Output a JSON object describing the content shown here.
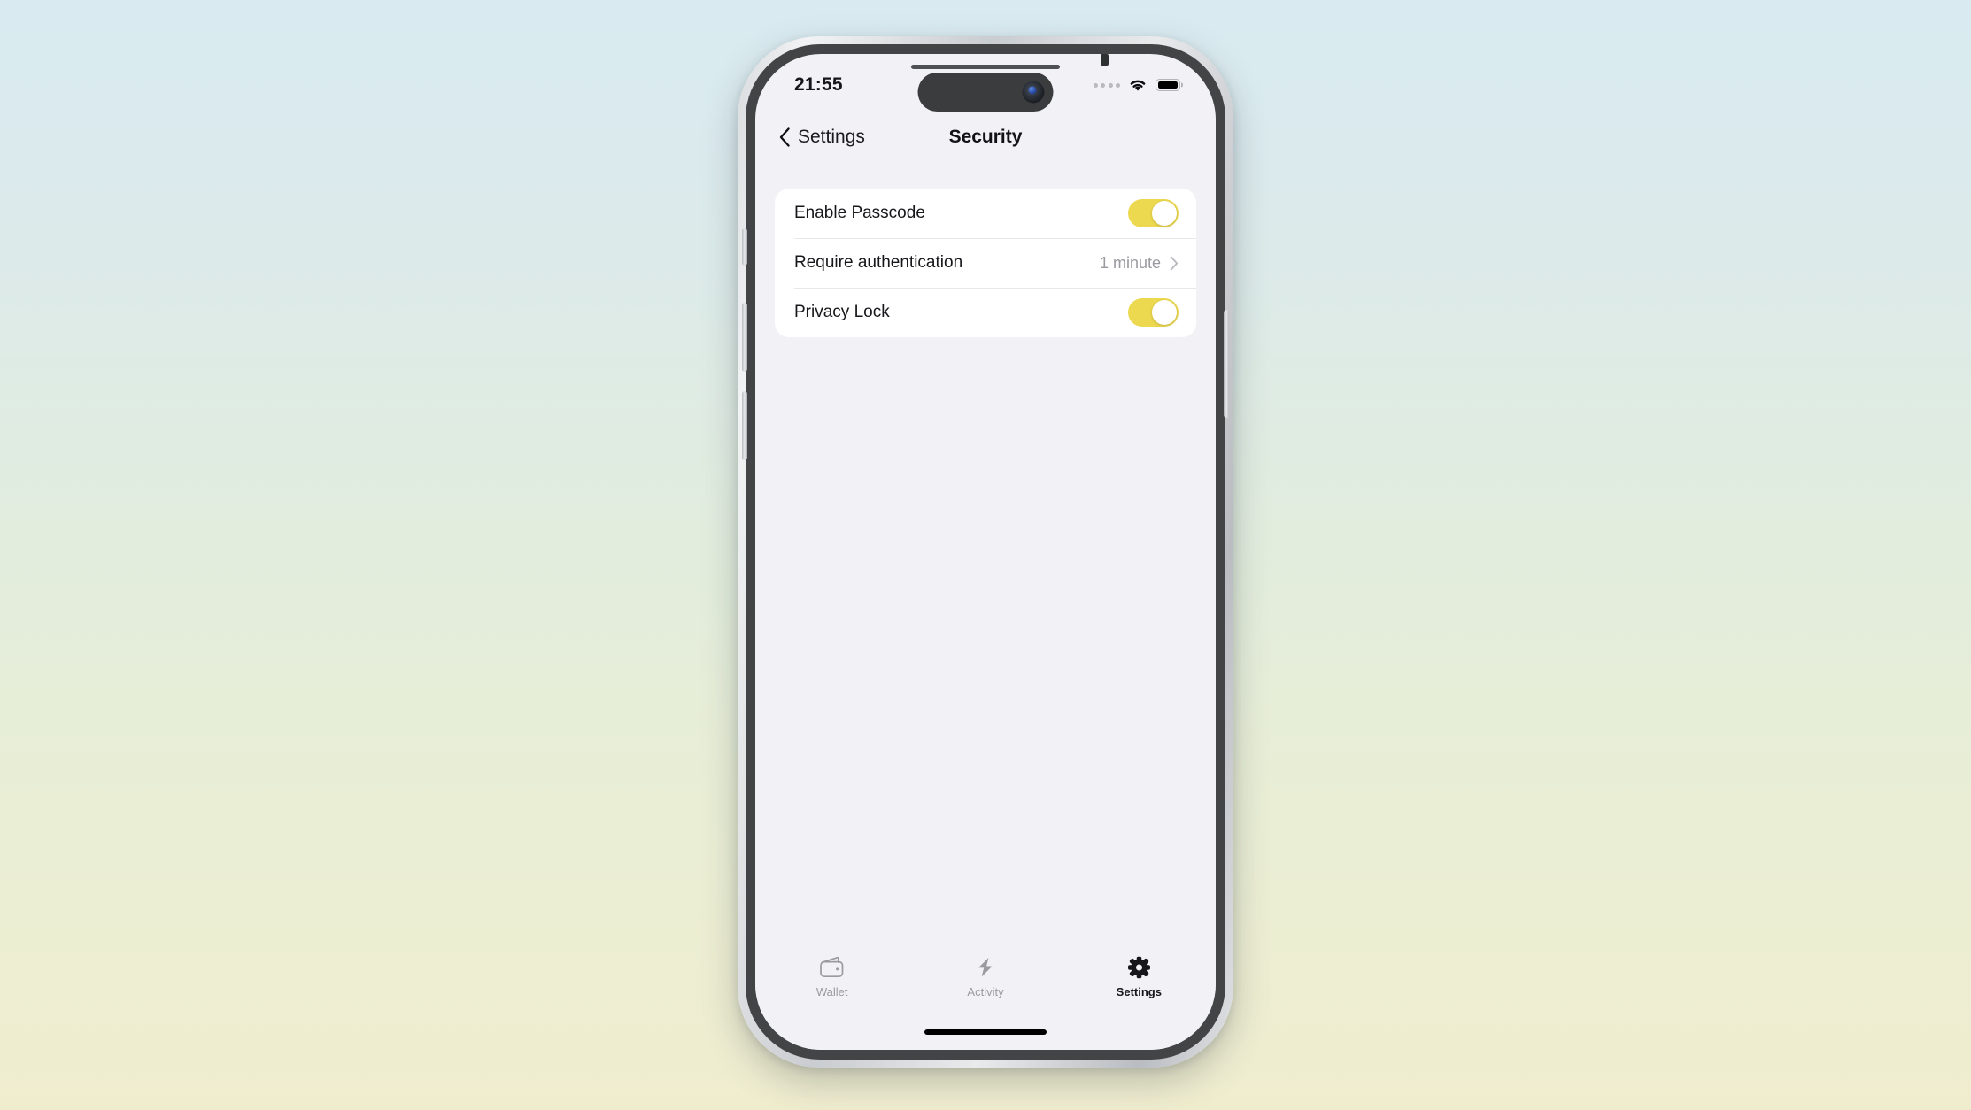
{
  "status_bar": {
    "time": "21:55",
    "signal_icon": "signal-dots-icon",
    "signal_dots": 4,
    "wifi_icon": "wifi-icon",
    "battery_icon": "battery-icon"
  },
  "nav": {
    "back_icon": "chevron-left-icon",
    "back_label": "Settings",
    "title": "Security"
  },
  "settings_rows": [
    {
      "label": "Enable Passcode",
      "type": "toggle",
      "value": "on"
    },
    {
      "label": "Require authentication",
      "type": "disclosure",
      "value": "1 minute",
      "chevron_icon": "chevron-right-icon"
    },
    {
      "label": "Privacy Lock",
      "type": "toggle",
      "value": "on"
    }
  ],
  "tabs": [
    {
      "label": "Wallet",
      "icon": "wallet-icon",
      "active": false
    },
    {
      "label": "Activity",
      "icon": "bolt-icon",
      "active": false
    },
    {
      "label": "Settings",
      "icon": "gear-icon",
      "active": true
    }
  ],
  "colors": {
    "toggle_on": "#ECD94F",
    "screen_background": "#F2F1F6",
    "card_background": "#FFFFFF",
    "active_tab": "#16161A",
    "inactive_tab": "#9A9AA0",
    "wallpaper_top": "#D9EBF1",
    "wallpaper_mid": "#E2EDDE",
    "wallpaper_bottom": "#F0EDCF"
  }
}
